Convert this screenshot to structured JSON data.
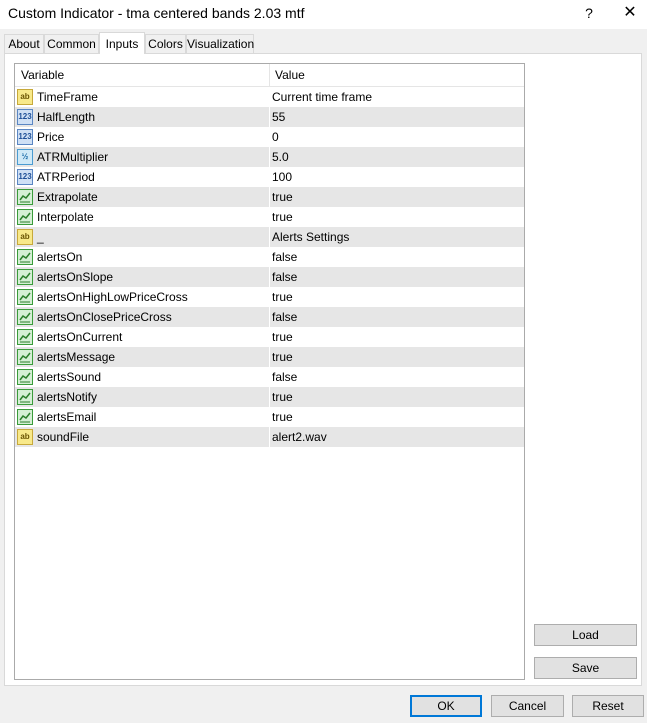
{
  "window": {
    "title": "Custom Indicator - tma centered bands 2.03 mtf",
    "help_label": "?",
    "close_label": "✕"
  },
  "tabs": [
    {
      "label": "About"
    },
    {
      "label": "Common"
    },
    {
      "label": "Inputs"
    },
    {
      "label": "Colors"
    },
    {
      "label": "Visualization"
    }
  ],
  "active_tab": "Inputs",
  "table": {
    "headers": {
      "variable": "Variable",
      "value": "Value"
    },
    "rows": [
      {
        "icon": "string",
        "name": "TimeFrame",
        "value": "Current time frame"
      },
      {
        "icon": "int",
        "name": "HalfLength",
        "value": "55"
      },
      {
        "icon": "int",
        "name": "Price",
        "value": "0"
      },
      {
        "icon": "double",
        "name": "ATRMultiplier",
        "value": "5.0"
      },
      {
        "icon": "int",
        "name": "ATRPeriod",
        "value": "100"
      },
      {
        "icon": "bool",
        "name": "Extrapolate",
        "value": "true"
      },
      {
        "icon": "bool",
        "name": "Interpolate",
        "value": "true"
      },
      {
        "icon": "string",
        "name": "_",
        "value": "Alerts Settings"
      },
      {
        "icon": "bool",
        "name": "alertsOn",
        "value": "false"
      },
      {
        "icon": "bool",
        "name": "alertsOnSlope",
        "value": "false"
      },
      {
        "icon": "bool",
        "name": "alertsOnHighLowPriceCross",
        "value": "true"
      },
      {
        "icon": "bool",
        "name": "alertsOnClosePriceCross",
        "value": "false"
      },
      {
        "icon": "bool",
        "name": "alertsOnCurrent",
        "value": "true"
      },
      {
        "icon": "bool",
        "name": "alertsMessage",
        "value": "true"
      },
      {
        "icon": "bool",
        "name": "alertsSound",
        "value": "false"
      },
      {
        "icon": "bool",
        "name": "alertsNotify",
        "value": "true"
      },
      {
        "icon": "bool",
        "name": "alertsEmail",
        "value": "true"
      },
      {
        "icon": "string",
        "name": "soundFile",
        "value": "alert2.wav"
      }
    ]
  },
  "icon_glyphs": {
    "string": "ab",
    "int": "123",
    "double": "½"
  },
  "buttons": {
    "load": "Load",
    "save": "Save",
    "ok": "OK",
    "cancel": "Cancel",
    "reset": "Reset"
  },
  "colors": {
    "default_button_border": "#0078d7",
    "alt_row": "#e6e6e6"
  }
}
